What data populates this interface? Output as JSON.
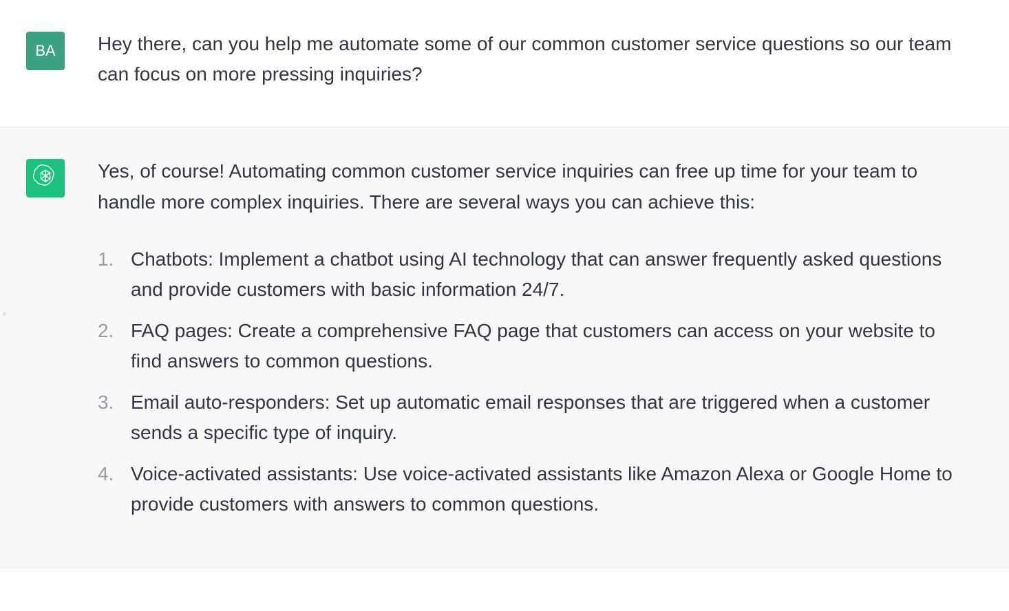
{
  "user": {
    "avatar_initials": "BA",
    "message": "Hey there, can you help me automate some of our common customer service questions so our team can focus on more pressing inquiries?"
  },
  "assistant": {
    "intro": "Yes, of course! Automating common customer service inquiries can free up time for your team to handle more complex inquiries. There are several ways you can achieve this:",
    "items": [
      "Chatbots: Implement a chatbot using AI technology that can answer frequently asked questions and provide customers with basic information 24/7.",
      "FAQ pages: Create a comprehensive FAQ page that customers can access on your website to find answers to common questions.",
      "Email auto-responders: Set up automatic email responses that are triggered when a customer sends a specific type of inquiry.",
      "Voice-activated assistants: Use voice-activated assistants like Amazon Alexa or Google Home to provide customers with answers to common questions."
    ]
  }
}
